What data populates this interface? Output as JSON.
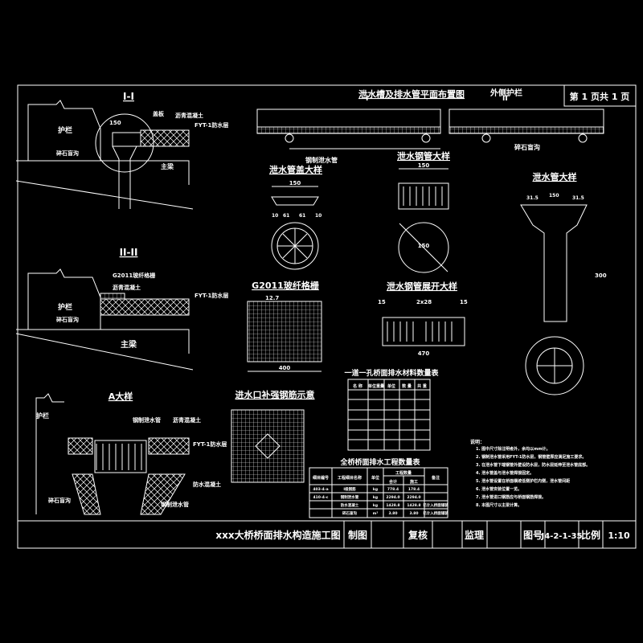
{
  "sheet": {
    "page_label": "第 1 页共 1 页"
  },
  "plan": {
    "title": "泄水槽及排水管平面布置图",
    "outer_rail": "外侧护栏",
    "sec1": "I",
    "sec2": "II",
    "pipe_label": "钢制泄水管",
    "pipe_label2": "碎石盲沟"
  },
  "section1": {
    "title": "I-I",
    "rail": "护栏",
    "girder": "主梁",
    "gravel": "碎石盲沟",
    "membrane": "FYT-1防水层",
    "asphalt": "沥青混凝土",
    "cover": "盖板",
    "dim": "150"
  },
  "section2": {
    "title": "II-II",
    "rail": "护栏",
    "girder": "主梁",
    "gravel": "碎石盲沟",
    "membrane": "FYT-1防水层",
    "grid": "G2011玻纤格栅",
    "asphalt": "沥青混凝土"
  },
  "detailA": {
    "title": "A大样",
    "rail": "护栏",
    "pipe": "钢制泄水管",
    "asphalt": "沥青混凝土",
    "membrane": "FYT-1防水层",
    "concrete": "防水混凝土",
    "gravel": "碎石盲沟",
    "steel": "钢制泄水管"
  },
  "cover_detail": {
    "title": "泄水管盖大样",
    "dim_total": "150",
    "dims": [
      "10",
      "61",
      "61",
      "10"
    ]
  },
  "steel_pipe_detail": {
    "title": "泄水钢管大样",
    "dim_width": "150",
    "dim_dia": "150"
  },
  "grid_detail": {
    "title": "G2011玻纤格栅",
    "dim": "12.7",
    "dim_bottom": "400"
  },
  "unfold_detail": {
    "title": "泄水钢管展开大样",
    "dims": [
      "15",
      "2x28",
      "15"
    ],
    "dim_bottom": "470"
  },
  "drain_pipe_detail": {
    "title": "泄水管大样",
    "dims": [
      "31.5",
      "150",
      "31.5"
    ],
    "dim_height": "300"
  },
  "rebar_detail": {
    "title": "进水口补强钢筋示意"
  },
  "table1": {
    "title": "一道一孔桥面排水材料数量表",
    "headers": [
      "名 称",
      "单位重量",
      "单位",
      "数 量",
      "共 重"
    ]
  },
  "table2": {
    "title": "全桥桥面排水工程数量表",
    "headers": [
      "细目编号",
      "工程细目名称",
      "单位",
      "工程数量",
      "备注"
    ],
    "subheaders": [
      "合计",
      "施工"
    ],
    "rows": [
      [
        "403-4-a",
        "I级钢筋",
        "kg",
        "778.4",
        "178.4",
        ""
      ],
      [
        "410-4-c",
        "钢制泄水管",
        "kg",
        "2294.0",
        "2294.0",
        ""
      ],
      [
        "",
        "防水混凝土",
        "kg",
        "1428.8",
        "1428.8",
        "已计入桥面铺装"
      ],
      [
        "",
        "碎石盲沟",
        "m³",
        "3.80",
        "3.80",
        "已计入桥面铺装"
      ]
    ]
  },
  "notes": {
    "title": "说明：",
    "items": [
      "1. 图中尺寸除注明者外，余均以mm计。",
      "2. 钢制泄水管采用FYT-1防水层，钢管壁厚应满足施工要求。",
      "3. 在泄水管下端钢管外壁设防水层，防水层延伸至泄水管底部。",
      "4. 泄水管盖与泄水管焊接固定。",
      "5. 泄水管设置在桥面横坡低侧护栏内侧，泄水管间距",
      "6. 泄水管安装位置一览。",
      "7. 泄水管进口钢筋应与桥面钢筋焊接。",
      "8. 本图尺寸以主梁计算。"
    ]
  },
  "title_block": {
    "drawing_title": "xxx大桥桥面排水构造施工图",
    "drawn": "制图",
    "checked": "复核",
    "supervised": "监理",
    "drawing_no_label": "图号",
    "drawing_no": "J4-2-1-35",
    "scale_label": "比例",
    "scale": "1:10"
  }
}
